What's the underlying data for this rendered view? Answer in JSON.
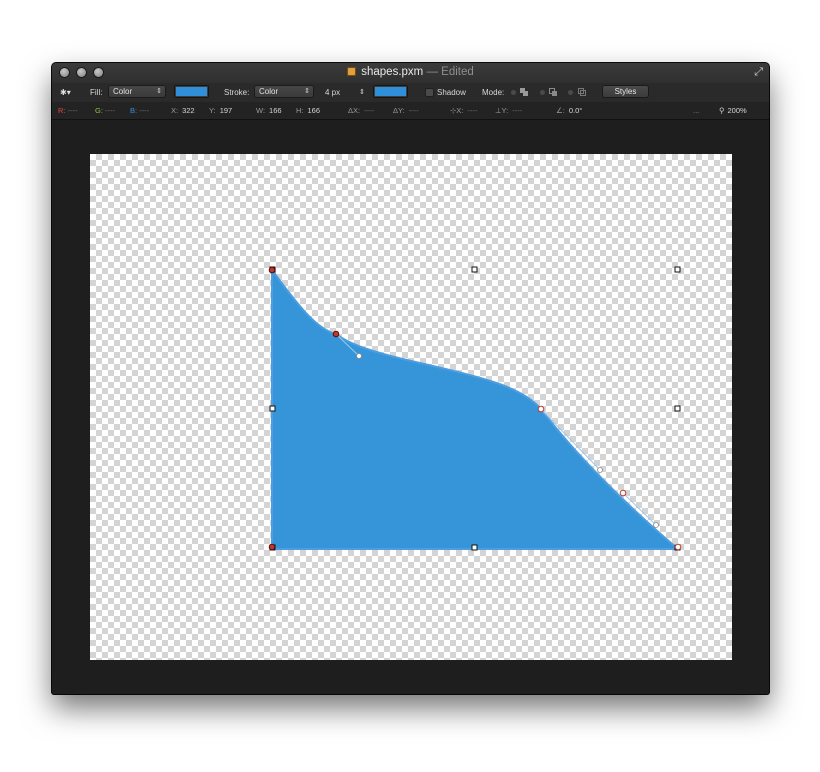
{
  "window": {
    "title": "shapes.pxm",
    "status": "— Edited",
    "fullscreen_icon": "⤢"
  },
  "toolbar": {
    "gear_icon": "✱▾",
    "fill_label": "Fill:",
    "fill_type": "Color",
    "fill_color": "#2f8fd8",
    "stroke_label": "Stroke:",
    "stroke_type": "Color",
    "stroke_width": "4 px",
    "stroke_color": "#2f8fd8",
    "shadow_label": "Shadow",
    "mode_label": "Mode:",
    "styles_label": "Styles"
  },
  "infobar": {
    "r_label": "R:",
    "g_label": "G:",
    "b_label": "B:",
    "empty": "----",
    "x_label": "X:",
    "x_value": "322",
    "y_label": "Y:",
    "y_value": "197",
    "w_label": "W:",
    "w_value": "166",
    "h_label": "H:",
    "h_value": "166",
    "dx_label": "ΔX:",
    "dy_label": "ΔY:",
    "px_label": "⊹X:",
    "py_label": "⊥Y:",
    "angle_label": "∠:",
    "angle_value": "0.0°",
    "ellipsis": "...",
    "zoom_value": "200%"
  },
  "shape": {
    "fill": "#3595d8",
    "stroke": "#4d9ee0"
  }
}
